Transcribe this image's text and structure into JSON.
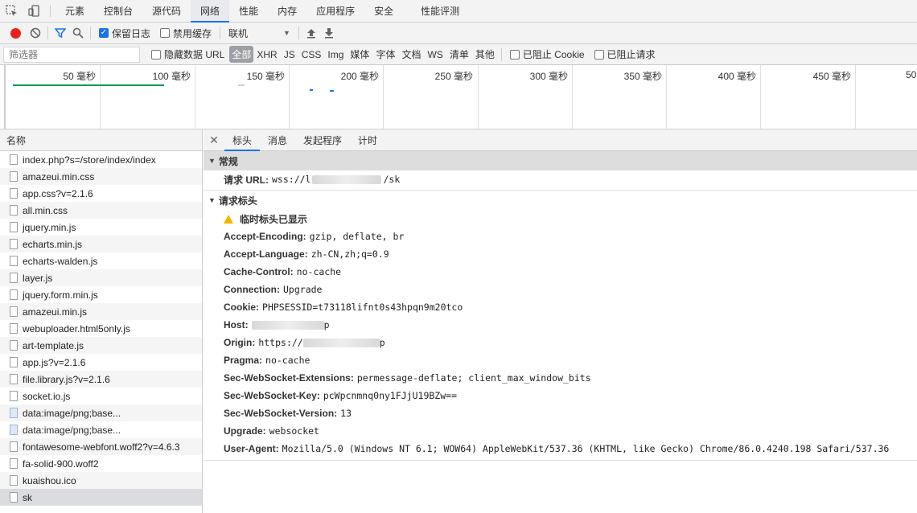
{
  "tabbar": {
    "tabs": [
      "元素",
      "控制台",
      "源代码",
      "网络",
      "性能",
      "内存",
      "应用程序",
      "安全",
      "性能评测"
    ],
    "active": "网络"
  },
  "toolbar": {
    "preserve_log": "保留日志",
    "disable_cache": "禁用缓存",
    "throttle_value": "联机"
  },
  "filterbar": {
    "placeholder": "筛选器",
    "hide_data_urls": "隐藏数据 URL",
    "types": [
      "全部",
      "XHR",
      "JS",
      "CSS",
      "Img",
      "媒体",
      "字体",
      "文档",
      "WS",
      "清单",
      "其他"
    ],
    "active_type": "全部",
    "blocked_cookies": "已阻止 Cookie",
    "blocked_requests": "已阻止请求"
  },
  "timeline": {
    "ticks": [
      "50 毫秒",
      "100 毫秒",
      "150 毫秒",
      "200 毫秒",
      "250 毫秒",
      "300 毫秒",
      "350 毫秒",
      "400 毫秒",
      "450 毫秒",
      "50"
    ]
  },
  "list": {
    "header": "名称",
    "rows": [
      {
        "name": "index.php?s=/store/index/index",
        "type": "doc"
      },
      {
        "name": "amazeui.min.css",
        "type": "doc"
      },
      {
        "name": "app.css?v=2.1.6",
        "type": "doc"
      },
      {
        "name": "all.min.css",
        "type": "doc"
      },
      {
        "name": "jquery.min.js",
        "type": "doc"
      },
      {
        "name": "echarts.min.js",
        "type": "doc"
      },
      {
        "name": "echarts-walden.js",
        "type": "doc"
      },
      {
        "name": "layer.js",
        "type": "doc"
      },
      {
        "name": "jquery.form.min.js",
        "type": "doc"
      },
      {
        "name": "amazeui.min.js",
        "type": "doc"
      },
      {
        "name": "webuploader.html5only.js",
        "type": "doc"
      },
      {
        "name": "art-template.js",
        "type": "doc"
      },
      {
        "name": "app.js?v=2.1.6",
        "type": "doc"
      },
      {
        "name": "file.library.js?v=2.1.6",
        "type": "doc"
      },
      {
        "name": "socket.io.js",
        "type": "doc"
      },
      {
        "name": "data:image/png;base...",
        "type": "img"
      },
      {
        "name": "data:image/png;base...",
        "type": "img"
      },
      {
        "name": "fontawesome-webfont.woff2?v=4.6.3",
        "type": "doc"
      },
      {
        "name": "fa-solid-900.woff2",
        "type": "doc"
      },
      {
        "name": "kuaishou.ico",
        "type": "doc"
      },
      {
        "name": "sk",
        "type": "doc"
      }
    ],
    "selected": "sk"
  },
  "details": {
    "tabs": [
      "标头",
      "消息",
      "发起程序",
      "计时"
    ],
    "active_tab": "标头",
    "general": {
      "title": "常规",
      "request_url_key": "请求 URL:",
      "request_url_prefix": "wss://l",
      "request_url_suffix": "/sk"
    },
    "request_headers": {
      "title": "请求标头",
      "provisional": "临时标头已显示",
      "items": [
        {
          "k": "Accept-Encoding:",
          "v": "gzip, deflate, br"
        },
        {
          "k": "Accept-Language:",
          "v": "zh-CN,zh;q=0.9"
        },
        {
          "k": "Cache-Control:",
          "v": "no-cache"
        },
        {
          "k": "Connection:",
          "v": "Upgrade"
        },
        {
          "k": "Cookie:",
          "v": "PHPSESSID=t73118lifnt0s43hpqn9m20tco"
        },
        {
          "k": "Host:",
          "v": "p",
          "blur": 90
        },
        {
          "k": "Origin:",
          "v": "https://",
          "blur": 95,
          "after": "p"
        },
        {
          "k": "Pragma:",
          "v": "no-cache"
        },
        {
          "k": "Sec-WebSocket-Extensions:",
          "v": "permessage-deflate; client_max_window_bits"
        },
        {
          "k": "Sec-WebSocket-Key:",
          "v": "pcWpcnmnq0ny1FJjU19BZw=="
        },
        {
          "k": "Sec-WebSocket-Version:",
          "v": "13"
        },
        {
          "k": "Upgrade:",
          "v": "websocket"
        },
        {
          "k": "User-Agent:",
          "v": "Mozilla/5.0 (Windows NT 6.1; WOW64) AppleWebKit/537.36 (KHTML, like Gecko) Chrome/86.0.4240.198 Safari/537.36"
        }
      ]
    }
  }
}
